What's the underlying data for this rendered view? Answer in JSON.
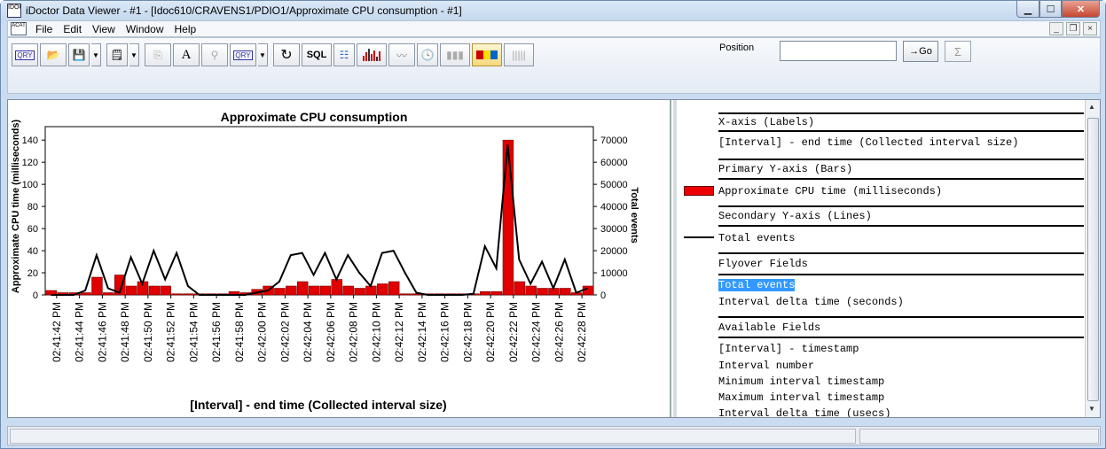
{
  "window": {
    "title": "iDoctor Data Viewer - #1 - [Idoc610/CRAVENS1/PDIO1/Approximate CPU consumption - #1]",
    "app_icon_text": "IDOC"
  },
  "menu": {
    "icon_text": "ACAT",
    "items": [
      "File",
      "Edit",
      "View",
      "Window",
      "Help"
    ]
  },
  "toolbar": {
    "sql_label": "SQL",
    "font_label": "A",
    "position_label": "Position",
    "position_value": "",
    "go_label": "→Go",
    "sigma_label": "Σ"
  },
  "chart_data": {
    "type": "bar",
    "title": "Approximate CPU consumption",
    "xlabel": "[Interval] - end time (Collected interval size)",
    "ylabel": "Approximate CPU time (milliseconds)",
    "y2label": "Total events",
    "ylim": [
      0,
      140
    ],
    "y2lim": [
      0,
      70000
    ],
    "yticks": [
      0,
      20,
      40,
      60,
      80,
      100,
      120,
      140
    ],
    "y2ticks": [
      0,
      10000,
      20000,
      30000,
      40000,
      50000,
      60000,
      70000
    ],
    "x_tick_labels": [
      "02:41:42 PM",
      "02:41:44 PM",
      "02:41:46 PM",
      "02:41:48 PM",
      "02:41:50 PM",
      "02:41:52 PM",
      "02:41:54 PM",
      "02:41:56 PM",
      "02:41:58 PM",
      "02:42:00 PM",
      "02:42:02 PM",
      "02:42:04 PM",
      "02:42:06 PM",
      "02:42:08 PM",
      "02:42:10 PM",
      "02:42:12 PM",
      "02:42:14 PM",
      "02:42:16 PM",
      "02:42:18 PM",
      "02:42:20 PM",
      "02:42:22 PM",
      "02:42:24 PM",
      "02:42:26 PM",
      "02:42:28 PM"
    ],
    "bars_ms": [
      4,
      2,
      2,
      2,
      16,
      2,
      18,
      8,
      12,
      8,
      8,
      1,
      1,
      1,
      1,
      1,
      3,
      2,
      5,
      8,
      6,
      8,
      12,
      8,
      8,
      14,
      8,
      6,
      8,
      10,
      12,
      1,
      1,
      1,
      1,
      1,
      1,
      1,
      3,
      3,
      140,
      12,
      8,
      6,
      6,
      6,
      2,
      8
    ],
    "line_events": [
      0,
      0,
      0,
      2000,
      18000,
      3000,
      1000,
      17000,
      5000,
      20000,
      7000,
      19000,
      4000,
      0,
      0,
      0,
      0,
      0,
      1000,
      2000,
      6000,
      18000,
      19000,
      9000,
      19000,
      7000,
      18000,
      10000,
      4000,
      19000,
      20000,
      10000,
      1000,
      0,
      0,
      0,
      0,
      500,
      22000,
      12000,
      68000,
      16000,
      5000,
      15000,
      3000,
      16000,
      1000,
      3000
    ],
    "grid": false,
    "legend": "right-pane"
  },
  "legend_pane": {
    "x_axis_header": "X-axis (Labels)",
    "x_axis_value": "[Interval] - end time (Collected interval size)",
    "primary_header": "Primary Y-axis (Bars)",
    "primary_value": "Approximate CPU time (milliseconds)",
    "secondary_header": "Secondary Y-axis (Lines)",
    "secondary_value": "Total events",
    "flyover_header": "Flyover Fields",
    "flyover_items": [
      "Total events",
      "Interval delta time (seconds)"
    ],
    "available_header": "Available Fields",
    "available_items": [
      "[Interval] - timestamp",
      "Interval number",
      "Minimum interval timestamp",
      "Maximum interval timestamp",
      "Interval delta time (usecs)"
    ]
  },
  "colors": {
    "bar": "#e00000",
    "line": "#000000",
    "highlight": "#3399ff"
  }
}
